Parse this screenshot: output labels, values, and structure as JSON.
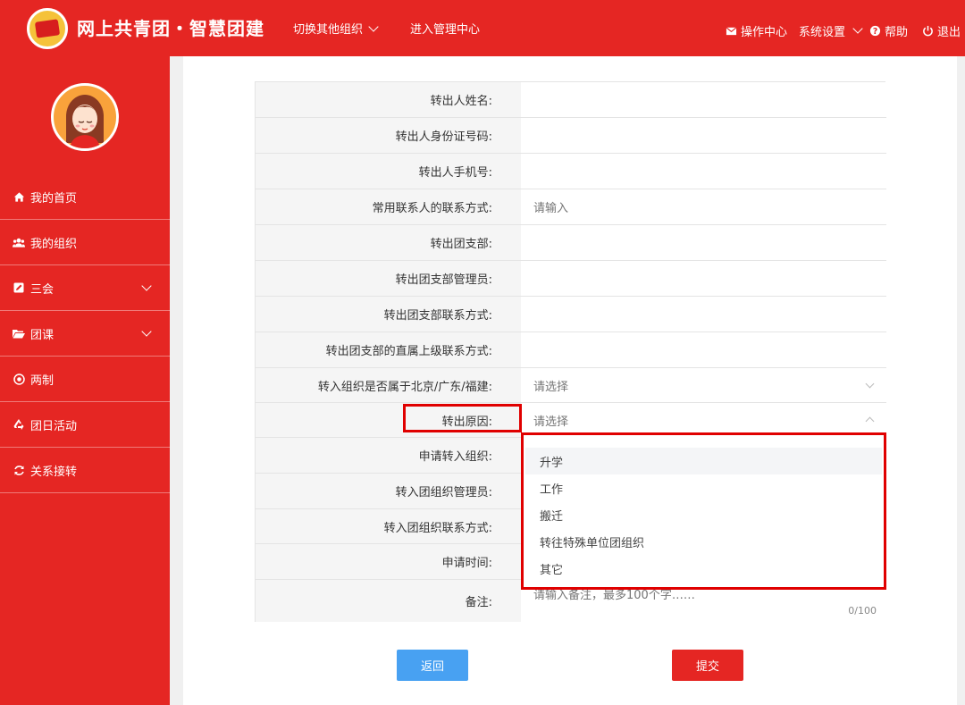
{
  "header": {
    "brand": "网上共青团・智慧团建",
    "switch_org": "切换其他组织",
    "admin_center": "进入管理中心",
    "ops_center": "操作中心",
    "settings": "系统设置",
    "help": "帮助",
    "logout": "退出"
  },
  "sidebar": {
    "items": [
      {
        "label": "我的首页",
        "icon": "home-icon"
      },
      {
        "label": "我的组织",
        "icon": "users-icon"
      },
      {
        "label": "三会",
        "icon": "edit-icon"
      },
      {
        "label": "团课",
        "icon": "folder-icon"
      },
      {
        "label": "两制",
        "icon": "target-icon"
      },
      {
        "label": "团日活动",
        "icon": "recycle-icon"
      },
      {
        "label": "关系接转",
        "icon": "refresh-icon"
      }
    ]
  },
  "form": {
    "rows": [
      {
        "label": "转出人姓名:",
        "value": ""
      },
      {
        "label": "转出人身份证号码:",
        "value": ""
      },
      {
        "label": "转出人手机号:",
        "value": ""
      },
      {
        "label": "常用联系人的联系方式:",
        "placeholder": "请输入"
      },
      {
        "label": "转出团支部:",
        "value": ""
      },
      {
        "label": "转出团支部管理员:",
        "value": ""
      },
      {
        "label": "转出团支部联系方式:",
        "value": ""
      },
      {
        "label": "转出团支部的直属上级联系方式:",
        "value": ""
      },
      {
        "label": "转入组织是否属于北京/广东/福建:",
        "placeholder": "请选择"
      },
      {
        "label": "转出原因:",
        "placeholder": "请选择"
      },
      {
        "label": "申请转入组织:",
        "value": ""
      },
      {
        "label": "转入团组织管理员:",
        "value": ""
      },
      {
        "label": "转入团组织联系方式:",
        "value": ""
      },
      {
        "label": "申请时间:",
        "value": ""
      },
      {
        "label": "备注:",
        "placeholder": "请输入备注，最多100个字……",
        "counter": "0/100"
      }
    ],
    "required_mark": "*"
  },
  "dropdown": {
    "options": [
      "升学",
      "工作",
      "搬迁",
      "转往特殊单位团组织",
      "其它"
    ]
  },
  "buttons": {
    "back": "返回",
    "submit": "提交"
  },
  "colors": {
    "brand_red": "#e52623",
    "highlight_red": "#e00000",
    "back_blue": "#48a1f2"
  }
}
